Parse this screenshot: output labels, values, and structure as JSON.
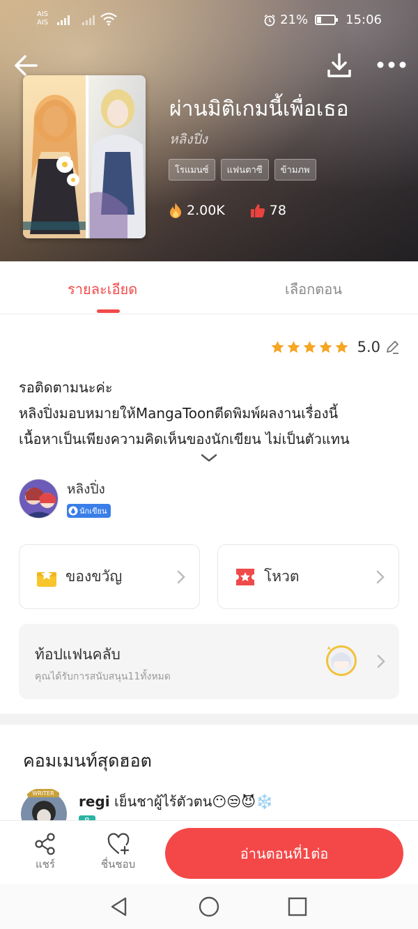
{
  "status_bar": {
    "carrier_1": "AIS",
    "carrier_2": "AIS",
    "battery": "21%",
    "battery_level": 0.21,
    "time": "15:06"
  },
  "comic": {
    "title": "ผ่านมิติเกมนี้เพื่อเธอ",
    "author": "หลิงปิ่ง",
    "tags": [
      "โรแมนซ์",
      "แฟนตาซี",
      "ข้ามภพ"
    ],
    "views": "2.00K",
    "likes": "78"
  },
  "tabs": {
    "detail": "รายละเอียด",
    "episodes": "เลือกตอน"
  },
  "rating": {
    "value": "5.0",
    "stars": 5
  },
  "description": {
    "line1": "รอติดตามนะค่ะ",
    "line2": "หลิงปิ่งมอบหมายให้MangaToonตีดพิมพ์ผลงานเรื่องนี้",
    "line3": "เนื้อหาเป็นเพียงความคิดเห็นของนักเขียน ไม่เป็นตัวแทน"
  },
  "author_card": {
    "name": "หลิงปิ่ง",
    "badge": "นักเขียน"
  },
  "actions": {
    "gift": "ของขวัญ",
    "vote": "โหวต"
  },
  "fanclub": {
    "title": "ท้อปแฟนคลับ",
    "subtitle": "คุณได้รับการสนับสนุน11ทั้งหมด"
  },
  "hot_comments": {
    "title": "คอมเมนท์สุดฮอต",
    "items": [
      {
        "user": "regi",
        "text": "เย็นชาผู้ไร้ตัวตน😶😒😈❄️",
        "level": "8",
        "avatar_tag": "WRITER"
      }
    ]
  },
  "bottom_bar": {
    "share": "แชร์",
    "like": "ชื่นชอบ",
    "read": "อ่านตอนที่1ต่อ"
  },
  "colors": {
    "accent": "#f24a4a",
    "read_button": "#f44848",
    "star": "#f5a623"
  },
  "icons": {
    "back": "back-arrow-icon",
    "download": "download-icon",
    "more": "more-dots-icon",
    "views": "fire-icon",
    "likes": "thumbs-up-icon",
    "edit": "pencil-icon",
    "expand": "chevron-down-icon",
    "gift": "gift-icon",
    "vote": "ticket-icon",
    "share": "share-icon",
    "like": "heart-plus-icon"
  }
}
